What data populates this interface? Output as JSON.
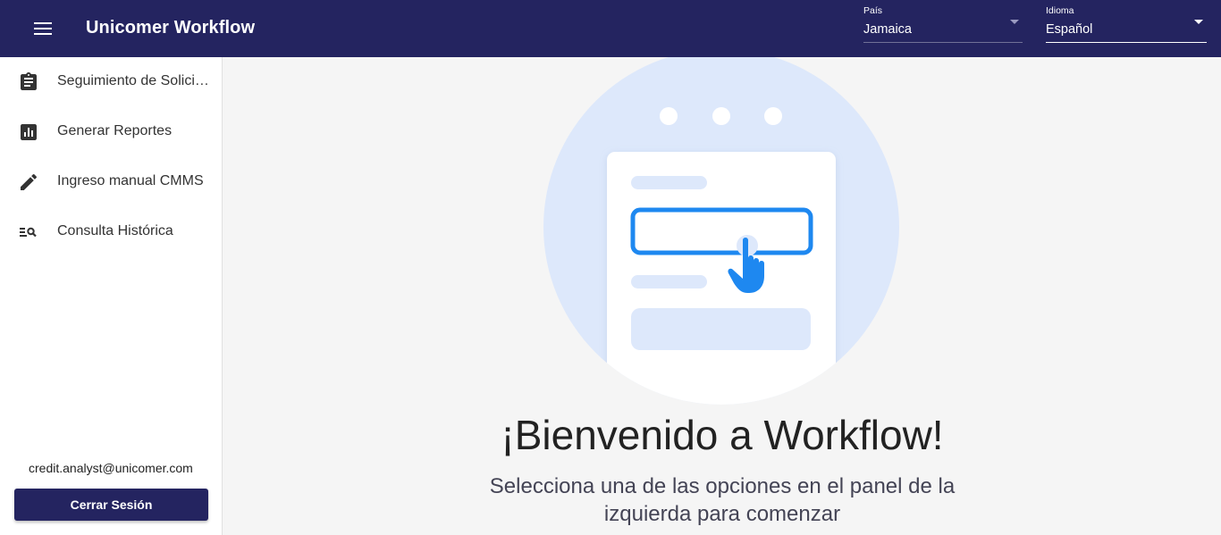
{
  "header": {
    "title": "Unicomer Workflow",
    "pais": {
      "label": "País",
      "value": "Jamaica"
    },
    "idioma": {
      "label": "Idioma",
      "value": "Español"
    }
  },
  "sidebar": {
    "items": [
      {
        "label": "Seguimiento de Solicitudes",
        "icon": "clipboard-icon"
      },
      {
        "label": "Generar Reportes",
        "icon": "bar-chart-icon"
      },
      {
        "label": "Ingreso manual CMMS",
        "icon": "pencil-icon"
      },
      {
        "label": "Consulta Histórica",
        "icon": "list-search-icon"
      }
    ],
    "user_email": "credit.analyst@unicomer.com",
    "logout_label": "Cerrar Sesión"
  },
  "main": {
    "title": "¡Bienvenido a Workflow!",
    "subtitle": "Selecciona una de las opciones en el panel de la izquierda para comenzar"
  },
  "colors": {
    "primary": "#242460",
    "illustration_circle": "#dde8fb",
    "accent_blue": "#1e88f0"
  }
}
